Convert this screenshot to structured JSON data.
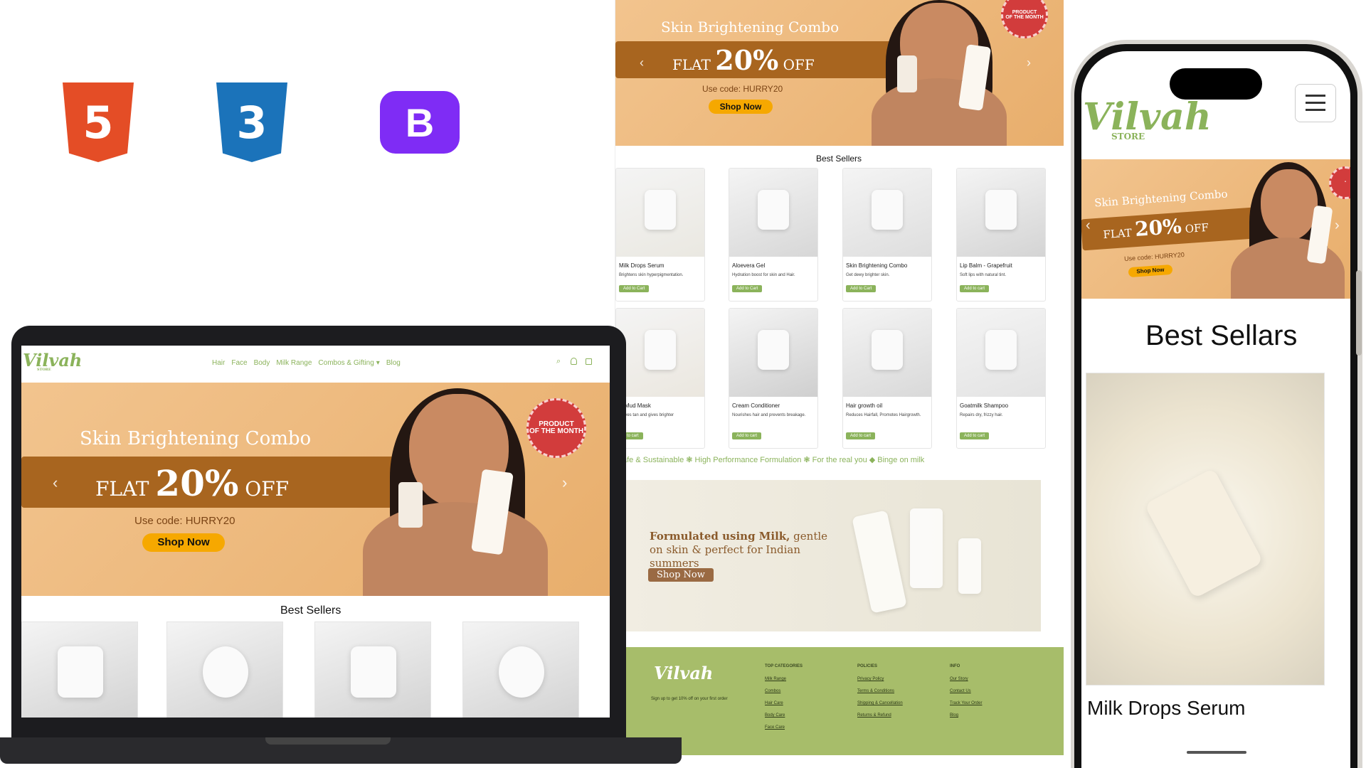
{
  "brand": {
    "name": "Vilvah",
    "sub": "STORE"
  },
  "colors": {
    "accent": "#8bb35b",
    "hero_band": "#a8651f",
    "hero_bg": "#eeb878",
    "button": "#f6a800",
    "footer_bg": "#a7bd6a"
  },
  "tech_logos": {
    "html": "5",
    "css": "3",
    "bootstrap": "B"
  },
  "nav": {
    "items": [
      "Hair",
      "Face",
      "Body",
      "Milk Range",
      "Combos & Gifting",
      "Blog"
    ],
    "icons": [
      "search-icon",
      "user-icon",
      "bag-icon"
    ]
  },
  "hero": {
    "title": "Skin Brightening Combo",
    "flat": "FLAT",
    "pct": "20%",
    "off": "OFF",
    "code": "Use code: HURRY20",
    "cta": "Shop Now",
    "badge_line1": "PRODUCT",
    "badge_line2": "OF THE MONTH"
  },
  "best_sellers_title": "Best Sellers",
  "products": [
    {
      "name": "Milk Drops Serum",
      "desc": "Brightens skin hyperpigmentation.",
      "btn": "Add to Cart"
    },
    {
      "name": "Aloevera Gel",
      "desc": "Hydration boost for skin and Hair.",
      "btn": "Add to Cart"
    },
    {
      "name": "Skin Brightening Combo",
      "desc": "Get dewy brighter skin.",
      "btn": "Add to Cart"
    },
    {
      "name": "Lip Balm - Grapefruit",
      "desc": "Soft lips with natural tint.",
      "btn": "Add to cart"
    },
    {
      "name": "lk Mud Mask",
      "desc": "moves tan and gives brighter",
      "btn": "d to cart"
    },
    {
      "name": "Cream Conditioner",
      "desc": "Nourishes hair and prevents breakage.",
      "btn": "Add to cart"
    },
    {
      "name": "Hair growth oil",
      "desc": "Reduces Hairfall, Promotes Hairgrowth.",
      "btn": "Add to cart"
    },
    {
      "name": "Goatmilk Shampoo",
      "desc": "Repairs dry, frizzy hair.",
      "btn": "Add to cart"
    }
  ],
  "marquee": "afe & Sustainable ❃ High Performance Formulation ❃ For the real you ◆ Binge on milk",
  "promo": {
    "bold": "Formulated using Milk,",
    "rest": " gentle on skin & perfect for Indian summers",
    "cta": "Shop Now"
  },
  "footer": {
    "tagline": "Sign up to get 10% off on your first order",
    "columns": [
      {
        "title": "TOP CATEGORIES",
        "links": [
          "Milk Range",
          "Combos",
          "Hair Care",
          "Body Care",
          "Face Care"
        ]
      },
      {
        "title": "POLICIES",
        "links": [
          "Privacy Policy",
          "Terms & Conditions",
          "Shipping & Cancellation",
          "Returns & Refund"
        ]
      },
      {
        "title": "INFO",
        "links": [
          "Our Story",
          "Contact Us",
          "Track Your Order",
          "Blog"
        ]
      }
    ]
  },
  "mobile": {
    "section": "Best Sellars",
    "product": "Milk Drops Serum"
  }
}
